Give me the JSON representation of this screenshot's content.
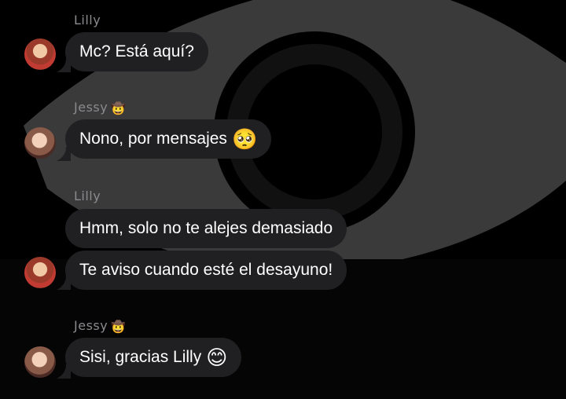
{
  "background": {
    "icon": "eye-icon",
    "color": "#3a3a3a"
  },
  "messages": [
    {
      "sender": "Lilly",
      "sender_emoji": "",
      "text": "Mc? Está aquí?",
      "emoji": ""
    },
    {
      "sender": "Jessy",
      "sender_emoji": "🤠",
      "text": "Nono, por mensajes",
      "emoji": "🥺"
    },
    {
      "sender": "Lilly",
      "sender_emoji": "",
      "text": "Hmm, solo no te alejes demasiado",
      "emoji": ""
    },
    {
      "sender": "",
      "sender_emoji": "",
      "text": "Te aviso cuando esté el desayuno!",
      "emoji": ""
    },
    {
      "sender": "Jessy",
      "sender_emoji": "🤠",
      "text": "Sisi, gracias Lilly",
      "emoji": "😊"
    }
  ],
  "colors": {
    "bubble": "#202022",
    "text": "#ffffff",
    "sender": "#8a8a8f",
    "background": "#000000"
  }
}
